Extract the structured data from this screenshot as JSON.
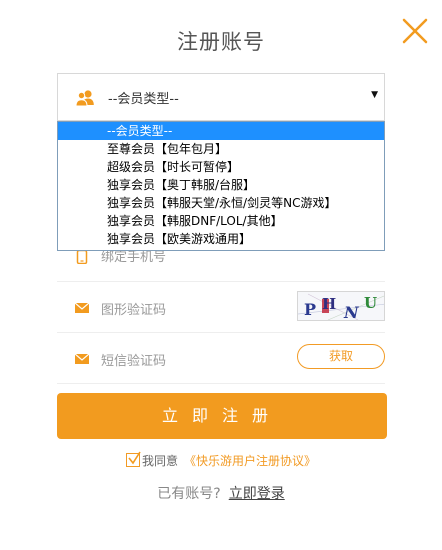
{
  "page": {
    "title": "注册账号"
  },
  "member_select": {
    "selected": "--会员类型--",
    "options": [
      "--会员类型--",
      "至尊会员【包年包月】",
      "超级会员【时长可暂停】",
      "独享会员【奥丁韩服/台服】",
      "独享会员【韩服天堂/永恒/剑灵等NC游戏】",
      "独享会员【韩服DNF/LOL/其他】",
      "独享会员【欧美游戏通用】"
    ]
  },
  "form": {
    "phone_placeholder": "绑定手机号",
    "captcha_placeholder": "图形验证码",
    "captcha_text": [
      "P",
      "H",
      "N",
      "U"
    ],
    "sms_placeholder": "短信验证码",
    "get_code_label": "获取",
    "submit_label": "立即注册"
  },
  "agreement": {
    "agree_text": "我同意",
    "link_text": "《快乐游用户注册协议》"
  },
  "login": {
    "prompt": "已有账号?",
    "link_text": "立即登录"
  },
  "colors": {
    "accent": "#f29b1f",
    "dropdown_highlight": "#1e90ff"
  },
  "icons": {
    "close": "close-icon",
    "user": "user-group-icon",
    "phone": "phone-icon",
    "captcha": "envelope-icon",
    "sms": "envelope-icon",
    "check": "check-icon"
  }
}
